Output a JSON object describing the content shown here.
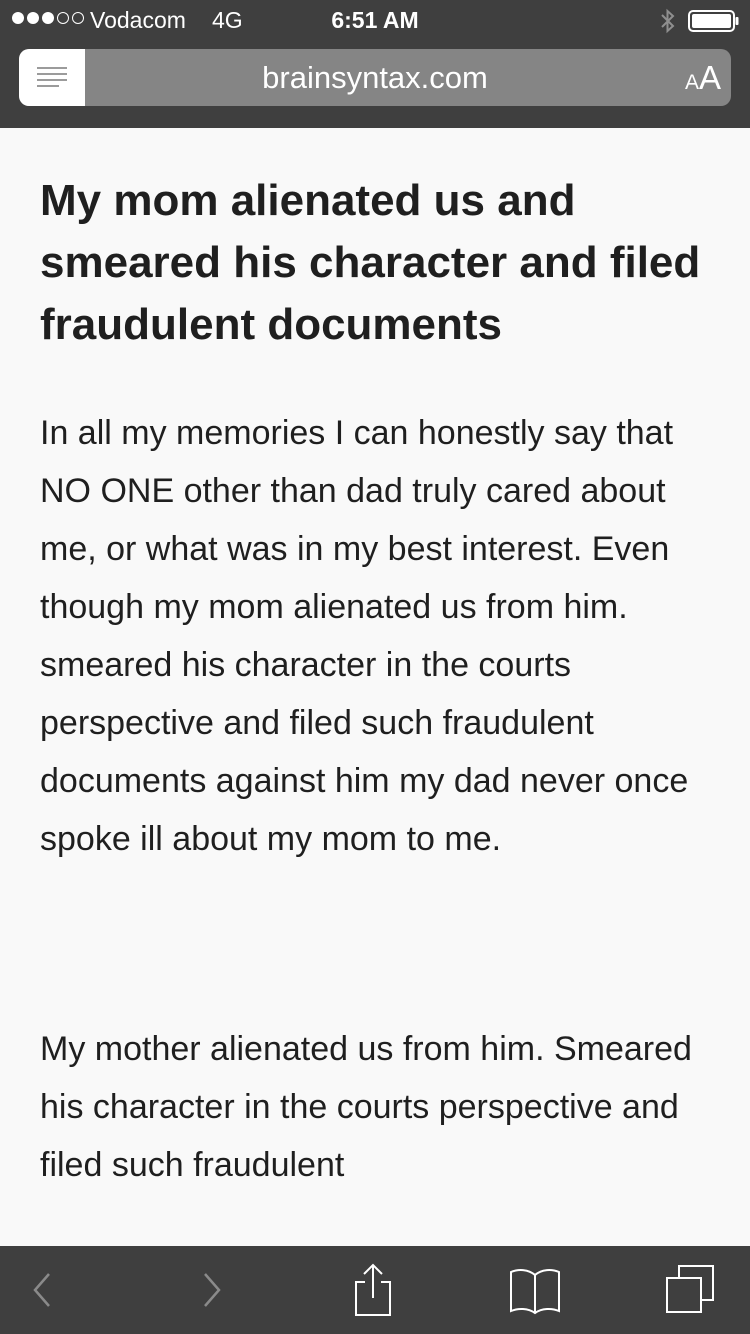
{
  "status_bar": {
    "signal_bars_filled": 3,
    "signal_bars_total": 5,
    "carrier": "Vodacom",
    "network": "4G",
    "time": "6:51 AM",
    "bluetooth_icon": "bluetooth-icon",
    "battery_icon": "battery-icon"
  },
  "browser": {
    "url": "brainsyntax.com",
    "reader_icon": "reader-view-icon",
    "text_size_label_small": "A",
    "text_size_label_big": "A"
  },
  "article": {
    "title": "My mom alienated us and smeared his character and filed fraudulent documents",
    "paragraphs": [
      "In all my memories I can honestly say that NO ONE other than dad truly cared about me, or what was in my best interest. Even though my mom alienated us from him. smeared his character in the courts perspective and filed such fraudulent documents against him my dad never once spoke ill about my mom to me.",
      "My mother alienated us from him. Smeared his character in the courts perspective and filed such fraudulent"
    ]
  },
  "toolbar": {
    "items": [
      "back-icon",
      "forward-icon",
      "share-icon",
      "bookmarks-icon",
      "tabs-icon"
    ]
  },
  "colors": {
    "chrome": "#3f3f3f",
    "url_field": "#858585",
    "page_background": "#f9f9f9",
    "text": "#1f1f1f",
    "disabled_icon": "#8a8a8a"
  }
}
